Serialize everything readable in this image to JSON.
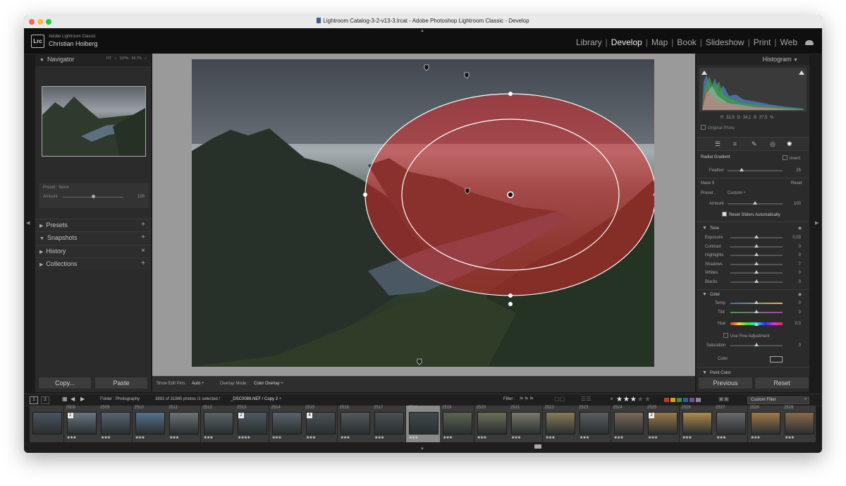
{
  "window": {
    "title": "Lightroom Catalog-3-2-v13-3.lrcat - Adobe Photoshop Lightroom Classic - Develop"
  },
  "identity": {
    "logo": "Lrc",
    "app": "Adobe Lightroom Classic",
    "user": "Christian Hoiberg"
  },
  "modules": [
    {
      "label": "Library",
      "active": false
    },
    {
      "label": "Develop",
      "active": true
    },
    {
      "label": "Map",
      "active": false
    },
    {
      "label": "Book",
      "active": false
    },
    {
      "label": "Slideshow",
      "active": false
    },
    {
      "label": "Print",
      "active": false
    },
    {
      "label": "Web",
      "active": false
    }
  ],
  "left": {
    "navigator": {
      "label": "Navigator",
      "fit": "FIT ÷",
      "zoom1": "100%",
      "zoom2": "66.7% ÷"
    },
    "preset": {
      "label": "Preset : None",
      "amount_label": "Amount",
      "amount": "100",
      "amount_fraction": 0.5
    },
    "sections": [
      {
        "label": "Presets",
        "action": "+",
        "open": false
      },
      {
        "label": "Snapshots",
        "action": "+",
        "open": true
      },
      {
        "label": "History",
        "action": "×",
        "open": false
      },
      {
        "label": "Collections",
        "action": "+",
        "open": false
      }
    ],
    "copy": "Copy...",
    "paste": "Paste"
  },
  "toolbar": {
    "show_pins_label": "Show Edit Pins :",
    "show_pins_value": "Auto ÷",
    "overlay_label": "Overlay Mode :",
    "overlay_value": "Color Overlay ÷"
  },
  "right": {
    "histogram": {
      "label": "Histogram",
      "r_label": "R",
      "r": "32,9",
      "g_label": "G",
      "g": "34,1",
      "b_label": "B",
      "b": "37,5",
      "pct": "%",
      "original": "Original Photo"
    },
    "mask": {
      "tool": "Radial Gradient",
      "invert": "Invert",
      "feather_label": "Feather",
      "feather": "25",
      "feather_fraction": 0.25,
      "mask_name": "Mask 5",
      "reset": "Reset",
      "preset_label": "Preset :",
      "preset_value": "Custom ÷",
      "amount_label": "Amount",
      "amount": "100",
      "amount_fraction": 0.5,
      "reset_sliders": "Reset Sliders Automatically"
    },
    "tone": {
      "label": "Tone",
      "sliders": [
        {
          "label": "Exposure",
          "value": "0,03"
        },
        {
          "label": "Contrast",
          "value": "0"
        },
        {
          "label": "Highlights",
          "value": "0"
        },
        {
          "label": "Shadows",
          "value": "7"
        },
        {
          "label": "Whites",
          "value": "0"
        },
        {
          "label": "Blacks",
          "value": "0"
        }
      ]
    },
    "color": {
      "label": "Color",
      "temp_label": "Temp",
      "temp": "0",
      "tint_label": "Tint",
      "tint": "0",
      "hue_label": "Hue",
      "hue": "0,0",
      "fine": "Use Fine Adjustment",
      "sat_label": "Saturation",
      "sat": "0",
      "color_label": "Color"
    },
    "point_color": "Point Color",
    "previous": "Previous",
    "reset": "Reset"
  },
  "filterbar": {
    "page1": "1",
    "page2": "2",
    "folder": "Folder : Photography",
    "count": "3892 of 31865 photos /1 selected /",
    "file": "_DSC0089.NEF / Copy 2 ÷",
    "filter_label": "Filter :",
    "rating_op": "≥",
    "stars_on": "★★★",
    "stars_off": "★★",
    "custom_filter": "Custom Filter",
    "flag_colors": [
      "#c0392b",
      "#d4a017",
      "#3f8f3f",
      "#2e5f9e",
      "#7a4a9a",
      "#8a8a8a"
    ]
  },
  "filmstrip": {
    "cells": [
      {
        "num": "",
        "stars": "",
        "badge": "",
        "thumb": "#4a5560"
      },
      {
        "num": "2508",
        "stars": "★★★",
        "badge": "2",
        "thumb": "#6a7680"
      },
      {
        "num": "2509",
        "stars": "★★★",
        "badge": "",
        "thumb": "#5a6570"
      },
      {
        "num": "2510",
        "stars": "★★★",
        "badge": "",
        "thumb": "#56738c"
      },
      {
        "num": "2511",
        "stars": "★★★",
        "badge": "",
        "thumb": "#6c7478"
      },
      {
        "num": "2512",
        "stars": "★★★",
        "badge": "",
        "thumb": "#5b6468"
      },
      {
        "num": "2513",
        "stars": "★★★★",
        "badge": "2",
        "thumb": "#4e5a62"
      },
      {
        "num": "2514",
        "stars": "★★★",
        "badge": "",
        "thumb": "#59636a"
      },
      {
        "num": "2515",
        "stars": "★★★",
        "badge": "4",
        "thumb": "#4b5257"
      },
      {
        "num": "2516",
        "stars": "★★★",
        "badge": "",
        "thumb": "#525a5e"
      },
      {
        "num": "2517",
        "stars": "★★★",
        "badge": "",
        "thumb": "#4a5055"
      },
      {
        "num": "2518",
        "stars": "★★★",
        "badge": "",
        "thumb": "#3f4a4e"
      },
      {
        "num": "2519",
        "stars": "★★★",
        "badge": "",
        "thumb": "#5b6650"
      },
      {
        "num": "2520",
        "stars": "★★★",
        "badge": "",
        "thumb": "#6a7058"
      },
      {
        "num": "2521",
        "stars": "★★★",
        "badge": "",
        "thumb": "#7a7a6a"
      },
      {
        "num": "2522",
        "stars": "★★★",
        "badge": "",
        "thumb": "#8a7c5a"
      },
      {
        "num": "2523",
        "stars": "★★★",
        "badge": "",
        "thumb": "#5a5e60"
      },
      {
        "num": "2524",
        "stars": "★★★",
        "badge": "",
        "thumb": "#7a6a5a"
      },
      {
        "num": "2525",
        "stars": "★★★",
        "badge": "2",
        "thumb": "#9a7a4a"
      },
      {
        "num": "2526",
        "stars": "★★★",
        "badge": "",
        "thumb": "#b08a50"
      },
      {
        "num": "2527",
        "stars": "★★★",
        "badge": "",
        "thumb": "#6a6a6a"
      },
      {
        "num": "2528",
        "stars": "★★★",
        "badge": "",
        "thumb": "#a07a4a"
      },
      {
        "num": "2529",
        "stars": "★★★",
        "badge": "",
        "thumb": "#8a6a4a"
      }
    ]
  },
  "colors": {
    "mask_overlay": "#d42a2a",
    "panel": "#2b2b2b",
    "canvas": "#9a9a9a"
  }
}
